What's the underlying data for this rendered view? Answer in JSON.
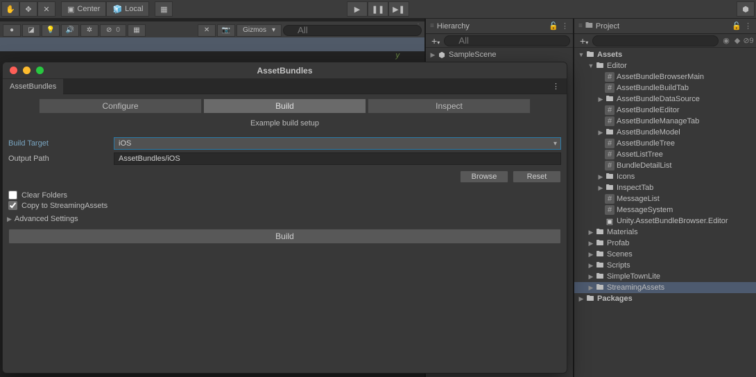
{
  "toolbar": {
    "center_label": "Center",
    "local_label": "Local",
    "gizmos_label": "Gizmos",
    "zero_badge": "0",
    "nine_badge": "9"
  },
  "hierarchy": {
    "title": "Hierarchy",
    "search_placeholder": "All",
    "scene": "SampleScene"
  },
  "project": {
    "title": "Project",
    "root": "Assets",
    "editor_folder": "Editor",
    "items": {
      "browser_main": "AssetBundleBrowserMain",
      "build_tab": "AssetBundleBuildTab",
      "data_source": "AssetBundleDataSource",
      "editor": "AssetBundleEditor",
      "manage_tab": "AssetBundleManageTab",
      "model": "AssetBundleModel",
      "tree": "AssetBundleTree",
      "asset_list_tree": "AssetListTree",
      "bundle_detail": "BundleDetailList",
      "icons": "Icons",
      "inspect_tab": "InspectTab",
      "message_list": "MessageList",
      "message_system": "MessageSystem",
      "unity_editor": "Unity.AssetBundleBrowser.Editor"
    },
    "folders": {
      "materials": "Materials",
      "profab": "Profab",
      "scenes": "Scenes",
      "scripts": "Scripts",
      "simple_town": "SimpleTownLite",
      "streaming_assets": "StreamingAssets"
    },
    "packages": "Packages"
  },
  "modal": {
    "title": "AssetBundles",
    "tab": "AssetBundles",
    "subtabs": {
      "configure": "Configure",
      "build": "Build",
      "inspect": "Inspect"
    },
    "setup_text": "Example build setup",
    "build_target_label": "Build Target",
    "build_target_value": "iOS",
    "output_path_label": "Output Path",
    "output_path_value": "AssetBundles/iOS",
    "browse_btn": "Browse",
    "reset_btn": "Reset",
    "clear_folders": "Clear Folders",
    "copy_streaming": "Copy to StreamingAssets",
    "advanced": "Advanced Settings",
    "build_btn": "Build"
  },
  "scene": {
    "axis_y": "y",
    "search_placeholder": "All"
  }
}
